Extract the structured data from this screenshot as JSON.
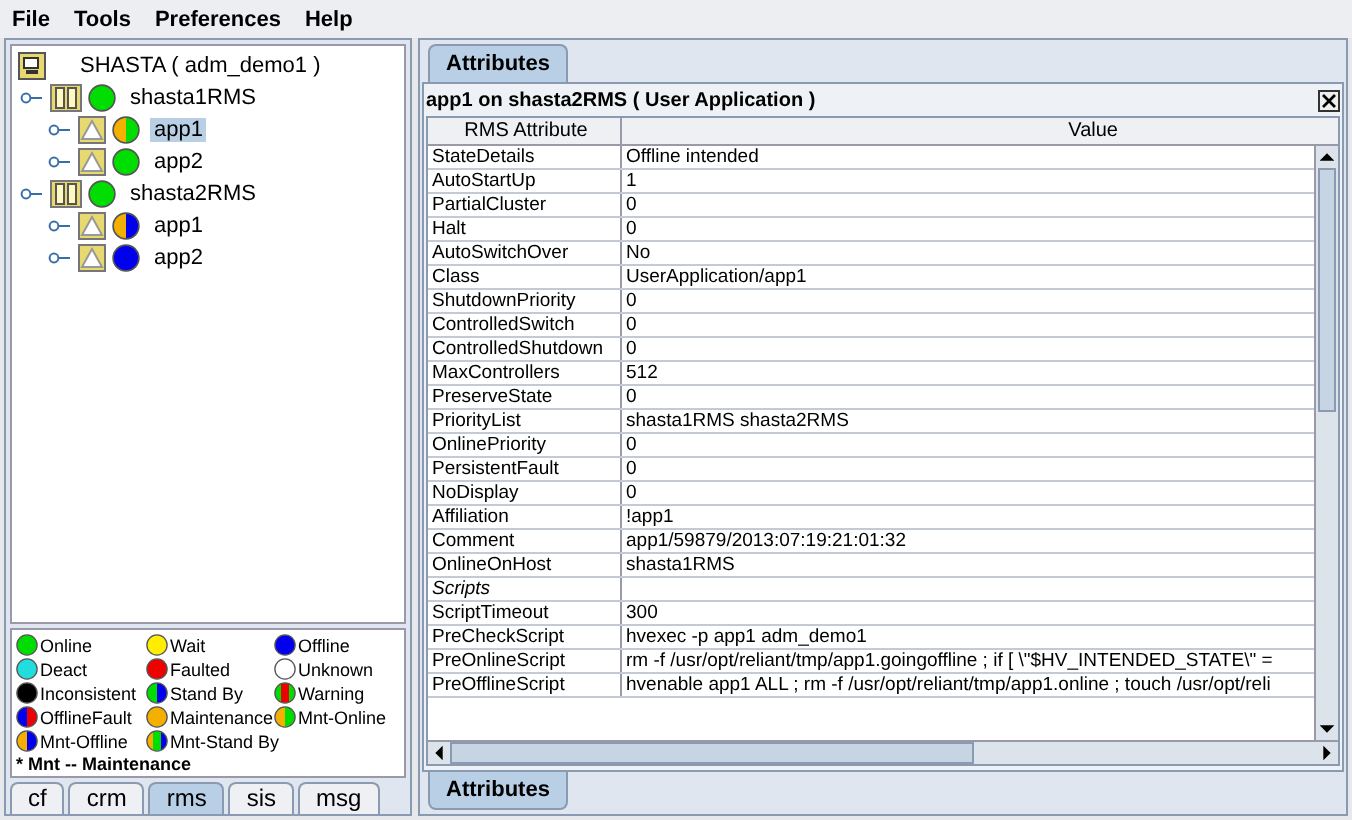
{
  "menu": [
    "File",
    "Tools",
    "Preferences",
    "Help"
  ],
  "tree": {
    "label": "SHASTA ( adm_demo1 )",
    "children": [
      {
        "label": "shasta1RMS",
        "segments": [
          {
            "color": "#00dd00"
          }
        ],
        "children": [
          {
            "label": "app1",
            "segments": [
              {
                "color": "#f4b000"
              },
              {
                "color": "#00dd00"
              }
            ],
            "selected": true
          },
          {
            "label": "app2",
            "segments": [
              {
                "color": "#00dd00"
              }
            ],
            "selected": false
          }
        ]
      },
      {
        "label": "shasta2RMS",
        "segments": [
          {
            "color": "#00dd00"
          }
        ],
        "children": [
          {
            "label": "app1",
            "segments": [
              {
                "color": "#f4b000"
              },
              {
                "color": "#0000ee"
              }
            ],
            "selected": false
          },
          {
            "label": "app2",
            "segments": [
              {
                "color": "#0000ee"
              }
            ],
            "selected": false
          }
        ]
      }
    ]
  },
  "legend": [
    {
      "label": "Online",
      "segments": [
        {
          "color": "#00dd00"
        }
      ]
    },
    {
      "label": "Wait",
      "segments": [
        {
          "color": "#ffee00"
        }
      ]
    },
    {
      "label": "Offline",
      "segments": [
        {
          "color": "#0000ee"
        }
      ]
    },
    {
      "label": "Deact",
      "segments": [
        {
          "color": "#22dddd"
        }
      ]
    },
    {
      "label": "Faulted",
      "segments": [
        {
          "color": "#ee0000"
        }
      ]
    },
    {
      "label": "Unknown",
      "segments": [
        {
          "color": "#ffffff"
        }
      ]
    },
    {
      "label": "Inconsistent",
      "segments": [
        {
          "color": "#000000"
        }
      ]
    },
    {
      "label": "Stand By",
      "segments": [
        {
          "color": "#00dd00"
        },
        {
          "color": "#0000ee"
        }
      ]
    },
    {
      "label": "Warning",
      "segments": [
        {
          "color": "#00dd00"
        },
        {
          "color": "#ee0000"
        },
        {
          "color": "#00dd00"
        }
      ]
    },
    {
      "label": "OfflineFault",
      "segments": [
        {
          "color": "#0000ee"
        },
        {
          "color": "#ee0000"
        }
      ]
    },
    {
      "label": "Maintenance",
      "segments": [
        {
          "color": "#f4b000"
        }
      ]
    },
    {
      "label": "Mnt-Online",
      "segments": [
        {
          "color": "#f4b000"
        },
        {
          "color": "#00dd00"
        }
      ]
    },
    {
      "label": "Mnt-Offline",
      "segments": [
        {
          "color": "#f4b000"
        },
        {
          "color": "#0000ee"
        }
      ]
    },
    {
      "label": "Mnt-Stand By",
      "segments": [
        {
          "color": "#f4b000"
        },
        {
          "color": "#00dd00"
        },
        {
          "color": "#0000ee"
        }
      ]
    }
  ],
  "legend_note": "* Mnt -- Maintenance",
  "left_tabs": [
    {
      "label": "cf",
      "selected": false
    },
    {
      "label": "crm",
      "selected": false
    },
    {
      "label": "rms",
      "selected": true
    },
    {
      "label": "sis",
      "selected": false
    },
    {
      "label": "msg",
      "selected": false
    }
  ],
  "top_tabs": [
    {
      "label": "Attributes",
      "selected": true
    }
  ],
  "panel_title": "app1 on shasta2RMS ( User Application )",
  "table": {
    "columns": [
      "RMS Attribute",
      "Value"
    ],
    "rows": [
      {
        "kind": "attribute",
        "name": "StateDetails",
        "value": "Offline intended"
      },
      {
        "kind": "attribute",
        "name": "AutoStartUp",
        "value": "1"
      },
      {
        "kind": "attribute",
        "name": "PartialCluster",
        "value": "0"
      },
      {
        "kind": "attribute",
        "name": "Halt",
        "value": "0"
      },
      {
        "kind": "attribute",
        "name": "AutoSwitchOver",
        "value": "No"
      },
      {
        "kind": "attribute",
        "name": "Class",
        "value": "UserApplication/app1"
      },
      {
        "kind": "attribute",
        "name": "ShutdownPriority",
        "value": "0"
      },
      {
        "kind": "attribute",
        "name": "ControlledSwitch",
        "value": "0"
      },
      {
        "kind": "attribute",
        "name": "ControlledShutdown",
        "value": "0"
      },
      {
        "kind": "attribute",
        "name": "MaxControllers",
        "value": "512"
      },
      {
        "kind": "attribute",
        "name": "PreserveState",
        "value": "0"
      },
      {
        "kind": "attribute",
        "name": "PriorityList",
        "value": "shasta1RMS shasta2RMS"
      },
      {
        "kind": "attribute",
        "name": "OnlinePriority",
        "value": "0"
      },
      {
        "kind": "attribute",
        "name": "PersistentFault",
        "value": "0"
      },
      {
        "kind": "attribute",
        "name": "NoDisplay",
        "value": "0"
      },
      {
        "kind": "attribute",
        "name": "Affiliation",
        "value": "!app1"
      },
      {
        "kind": "attribute",
        "name": "Comment",
        "value": "app1/59879/2013:07:19:21:01:32"
      },
      {
        "kind": "attribute",
        "name": "OnlineOnHost",
        "value": "shasta1RMS"
      },
      {
        "kind": "section",
        "name": "Scripts"
      },
      {
        "kind": "attribute",
        "name": "ScriptTimeout",
        "value": "300"
      },
      {
        "kind": "attribute",
        "name": "PreCheckScript",
        "value": "hvexec -p app1 adm_demo1"
      },
      {
        "kind": "attribute",
        "name": "PreOnlineScript",
        "value": "rm -f /usr/opt/reliant/tmp/app1.goingoffline ; if [ \\\"$HV_INTENDED_STATE\\\" ="
      },
      {
        "kind": "attribute",
        "name": "PreOfflineScript",
        "value": "hvenable app1 ALL ; rm -f /usr/opt/reliant/tmp/app1.online ; touch /usr/opt/reli"
      }
    ]
  },
  "bottom_tabs": [
    {
      "label": "Attributes",
      "selected": true
    }
  ]
}
